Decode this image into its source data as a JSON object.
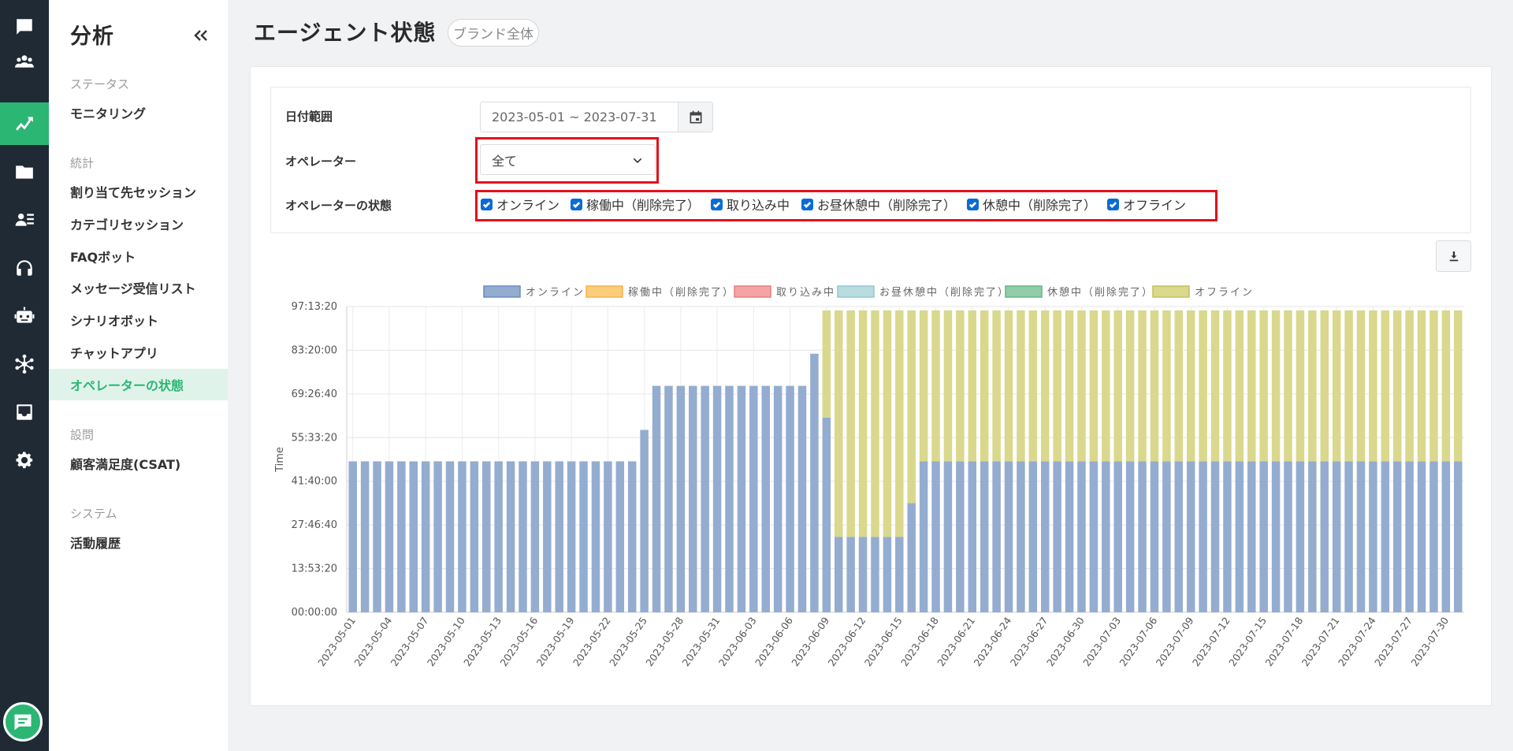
{
  "rail": {
    "items": [
      {
        "icon": "chat-bubble-icon"
      },
      {
        "icon": "users-icon"
      },
      {
        "icon": "analytics-icon",
        "active": true
      },
      {
        "icon": "folder-icon"
      },
      {
        "icon": "contact-list-icon"
      },
      {
        "icon": "headset-icon"
      },
      {
        "icon": "bot-icon"
      },
      {
        "icon": "network-icon"
      },
      {
        "icon": "inbox-icon"
      },
      {
        "icon": "gear-icon"
      }
    ],
    "bottom_icon": "chat-widget-icon"
  },
  "sidenav": {
    "title": "分析",
    "sections": [
      {
        "label": "ステータス",
        "items": [
          "モニタリング"
        ]
      },
      {
        "label": "統計",
        "items": [
          "割り当て先セッション",
          "カテゴリセッション",
          "FAQボット",
          "メッセージ受信リスト",
          "シナリオボット",
          "チャットアプリ",
          "オペレーターの状態"
        ]
      },
      {
        "label": "設問",
        "items": [
          "顧客満足度(CSAT)"
        ]
      },
      {
        "label": "システム",
        "items": [
          "活動履歴"
        ]
      }
    ],
    "active_item": "オペレーターの状態"
  },
  "header": {
    "title": "エージェント状態",
    "badge": "ブランド全体"
  },
  "filters": {
    "date_label": "日付範囲",
    "date_value": "2023-05-01 ~ 2023-07-31",
    "operator_label": "オペレーター",
    "operator_value": "全て",
    "status_label": "オペレーターの状態",
    "statuses": [
      {
        "label": "オンライン",
        "checked": true
      },
      {
        "label": "稼働中（削除完了）",
        "checked": true
      },
      {
        "label": "取り込み中",
        "checked": true
      },
      {
        "label": "お昼休憩中（削除完了）",
        "checked": true
      },
      {
        "label": "休憩中（削除完了）",
        "checked": true
      },
      {
        "label": "オフライン",
        "checked": true
      }
    ]
  },
  "colors": {
    "accent": "#2bb673",
    "rail_bg": "#1f2a35",
    "highlight": "#e2111b"
  },
  "chart_data": {
    "type": "bar",
    "stacked": true,
    "ylabel": "Time",
    "y_ticks": [
      "00:00:00",
      "13:53:20",
      "27:46:40",
      "41:40:00",
      "55:33:20",
      "69:26:40",
      "83:20:00",
      "97:13:20"
    ],
    "ylim_seconds": [
      0,
      350000
    ],
    "legend_position": "top",
    "grid": true,
    "series": [
      {
        "name": "オンライン",
        "color": "#94acd0",
        "border": "#6b8cc0"
      },
      {
        "name": "稼働中（削除完了）",
        "color": "#fccd7a",
        "border": "#f5b14c"
      },
      {
        "name": "取り込み中",
        "color": "#f4a4a4",
        "border": "#e77f7f"
      },
      {
        "name": "お昼休憩中（削除完了）",
        "color": "#b9dce1",
        "border": "#93c7cf"
      },
      {
        "name": "休憩中（削除完了）",
        "color": "#91cda8",
        "border": "#62b685"
      },
      {
        "name": "オフライン",
        "color": "#d9d88d",
        "border": "#c4c25c"
      }
    ],
    "start_date": "2023-05-01",
    "num_days": 92,
    "online_seconds": [
      172800,
      172800,
      172800,
      172800,
      172800,
      172800,
      172800,
      172800,
      172800,
      172800,
      172800,
      172800,
      172800,
      172800,
      172800,
      172800,
      172800,
      172800,
      172800,
      172800,
      172800,
      172800,
      172800,
      172800,
      208800,
      259200,
      259200,
      259200,
      259200,
      259200,
      259200,
      259200,
      259200,
      259200,
      259200,
      259200,
      259200,
      259200,
      296000,
      223000,
      86400,
      86400,
      86400,
      86400,
      86400,
      86400,
      125000,
      172800,
      172800,
      172800,
      172800,
      172800,
      172800,
      172800,
      172800,
      172800,
      172800,
      172800,
      172800,
      172800,
      172800,
      172800,
      172800,
      172800,
      172800,
      172800,
      172800,
      172800,
      172800,
      172800,
      172800,
      172800,
      172800,
      172800,
      172800,
      172800,
      172800,
      172800,
      172800,
      172800,
      172800,
      172800,
      172800,
      172800,
      172800,
      172800,
      172800,
      172800,
      172800,
      172800,
      172800,
      172800
    ],
    "offline_seconds": [
      0,
      0,
      0,
      0,
      0,
      0,
      0,
      0,
      0,
      0,
      0,
      0,
      0,
      0,
      0,
      0,
      0,
      0,
      0,
      0,
      0,
      0,
      0,
      0,
      0,
      0,
      0,
      0,
      0,
      0,
      0,
      0,
      0,
      0,
      0,
      0,
      0,
      0,
      0,
      122600,
      259200,
      259200,
      259200,
      259200,
      259200,
      259200,
      220600,
      172800,
      172800,
      172800,
      172800,
      172800,
      172800,
      172800,
      172800,
      172800,
      172800,
      172800,
      172800,
      172800,
      172800,
      172800,
      172800,
      172800,
      172800,
      172800,
      172800,
      172800,
      172800,
      172800,
      172800,
      172800,
      172800,
      172800,
      172800,
      172800,
      172800,
      172800,
      172800,
      172800,
      172800,
      172800,
      172800,
      172800,
      172800,
      172800,
      172800,
      172800,
      172800,
      172800,
      172800,
      172800
    ]
  }
}
